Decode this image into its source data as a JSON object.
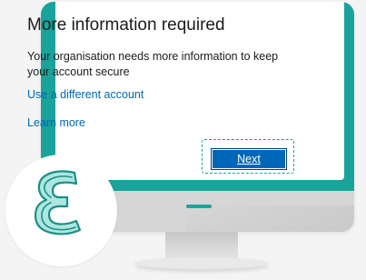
{
  "dialog": {
    "title": "More information required",
    "description": "Your organisation needs more information to keep your account secure",
    "use_different_account": "Use a different account",
    "learn_more": "Learn more",
    "next_label": "Next"
  },
  "colors": {
    "bezel": "#1aa39a",
    "link": "#0067b8",
    "primary_button": "#0067b8",
    "background": "#f4f4f4"
  },
  "icons": {
    "logo": "epsilon-logo-icon"
  }
}
